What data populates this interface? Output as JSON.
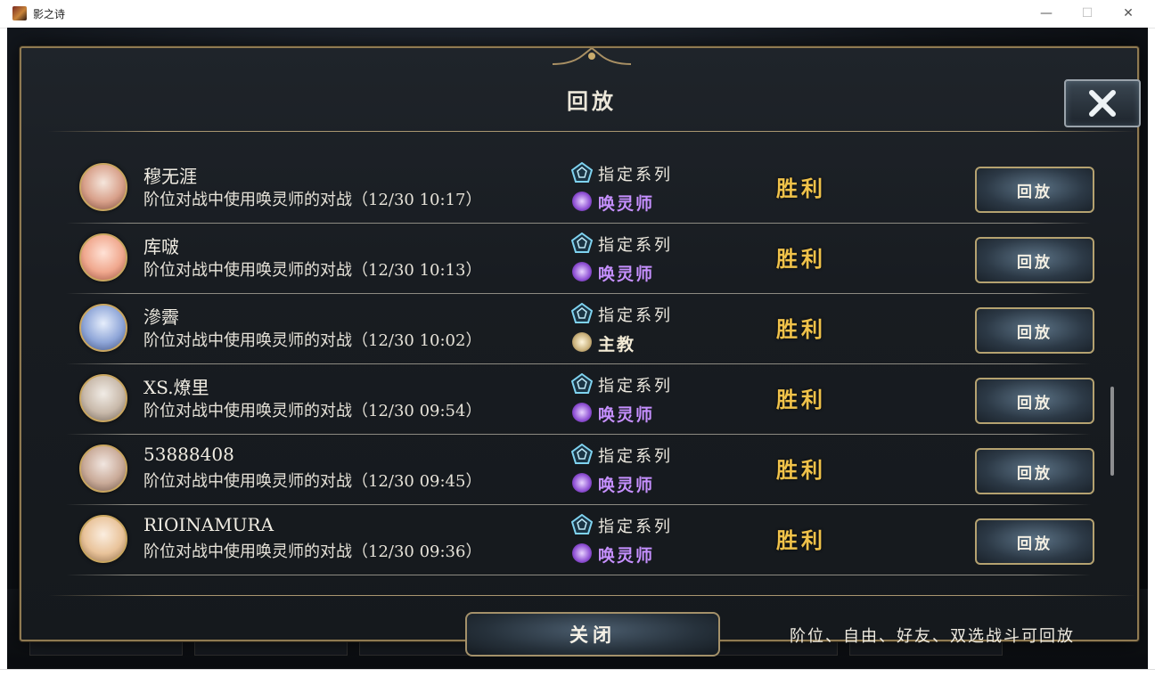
{
  "window": {
    "title": "影之诗"
  },
  "dialog": {
    "title": "回放",
    "close_button": "关闭",
    "footer_note": "阶位、自由、好友、双选战斗可回放"
  },
  "colors": {
    "gold_result": "#f0c24a",
    "panel_border": "#8f7a52",
    "summoner_purple": "#c690ff",
    "bishop_cream": "#f4ecd6"
  },
  "replays": [
    {
      "name": "穆无涯",
      "desc": "阶位对战中使用唤灵师的对战（12/30 10:17）",
      "format": "指定系列",
      "class": "唤灵师",
      "class_icon": "summoner-icon",
      "result": "胜利",
      "button": "回放"
    },
    {
      "name": "库啵",
      "desc": "阶位对战中使用唤灵师的对战（12/30 10:13）",
      "format": "指定系列",
      "class": "唤灵师",
      "class_icon": "summoner-icon",
      "result": "胜利",
      "button": "回放"
    },
    {
      "name": "滲霽",
      "desc": "阶位对战中使用唤灵师的对战（12/30 10:02）",
      "format": "指定系列",
      "class": "主教",
      "class_icon": "bishop-icon",
      "result": "胜利",
      "button": "回放"
    },
    {
      "name": "XS.燎里",
      "desc": "阶位对战中使用唤灵师的对战（12/30 09:54）",
      "format": "指定系列",
      "class": "唤灵师",
      "class_icon": "summoner-icon",
      "result": "胜利",
      "button": "回放"
    },
    {
      "name": "53888408",
      "desc": "阶位对战中使用唤灵师的对战（12/30 09:45）",
      "format": "指定系列",
      "class": "唤灵师",
      "class_icon": "summoner-icon",
      "result": "胜利",
      "button": "回放"
    },
    {
      "name": "RIOINAMURA",
      "desc": "阶位对战中使用唤灵师的对战（12/30 09:36）",
      "format": "指定系列",
      "class": "唤灵师",
      "class_icon": "summoner-icon",
      "result": "胜利",
      "button": "回放"
    }
  ]
}
